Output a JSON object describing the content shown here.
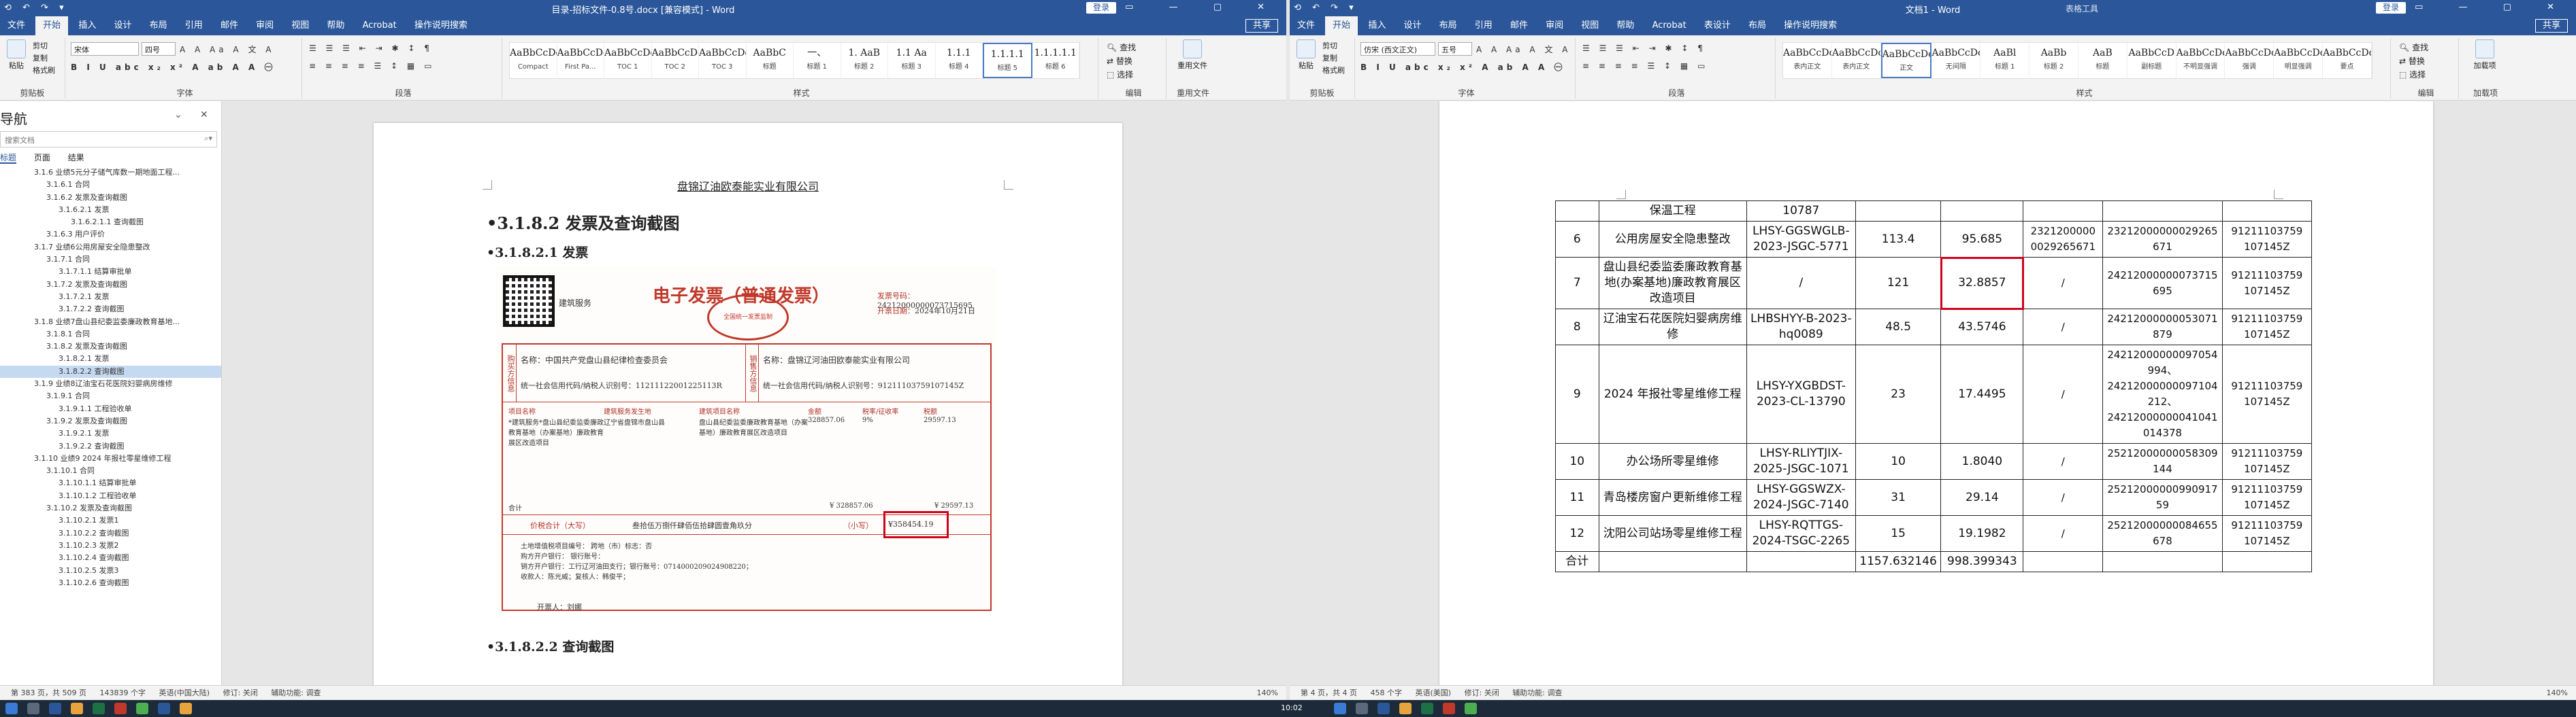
{
  "colors": {
    "accent": "#2b579a",
    "invoice_red": "#c0392b",
    "highlight": "#d0021b",
    "taskbar": "#1c2a3a"
  },
  "left": {
    "title": "目录-招标文件-0.8号.docx [兼容模式] - Word",
    "login": "登录",
    "tabs": [
      "文件",
      "开始",
      "插入",
      "设计",
      "布局",
      "引用",
      "邮件",
      "审阅",
      "视图",
      "帮助",
      "Acrobat",
      "操作说明搜索"
    ],
    "share": "共享",
    "clipboard": {
      "paste": "粘贴",
      "cut": "剪切",
      "copy": "复制",
      "painter": "格式刷",
      "label": "剪贴板"
    },
    "font": {
      "name": "宋体",
      "size": "四号",
      "label": "字体"
    },
    "paragraph_label": "段落",
    "styles": [
      {
        "pv": "AaBbCcDd",
        "nm": "Compact"
      },
      {
        "pv": "AaBbCcDd",
        "nm": "First Pa..."
      },
      {
        "pv": "AaBbCcDd",
        "nm": "TOC 1"
      },
      {
        "pv": "AaBbCcDd",
        "nm": "TOC 2"
      },
      {
        "pv": "AaBbCcDd",
        "nm": "TOC 3"
      },
      {
        "pv": "AaBbC",
        "nm": "标题"
      },
      {
        "pv": "一、",
        "nm": "标题 1"
      },
      {
        "pv": "1. AaB",
        "nm": "标题 2"
      },
      {
        "pv": "1.1 Aa",
        "nm": "标题 3"
      },
      {
        "pv": "1.1.1",
        "nm": "标题 4"
      },
      {
        "pv": "1.1.1.1",
        "nm": "标题 5"
      },
      {
        "pv": "1.1.1.1.1",
        "nm": "标题 6"
      }
    ],
    "styles_label": "样式",
    "editing": {
      "find": "查找",
      "replace": "替换",
      "select": "选择",
      "label": "编辑"
    },
    "reuse": {
      "btn": "重用文件",
      "label": "重用文件"
    },
    "nav": {
      "title": "导航",
      "search_placeholder": "搜索文档",
      "tabs": [
        "标题",
        "页面",
        "结果"
      ],
      "items": [
        "3.1.6 业绩5元分子储气库数一期地面工程...",
        "3.1.6.1 合同",
        "3.1.6.2 发票及查询截图",
        "3.1.6.2.1 发票",
        "3.1.6.2.1.1 查询截图",
        "3.1.6.3 用户评价",
        "3.1.7 业绩6公用房屋安全隐患整改",
        "3.1.7.1 合同",
        "3.1.7.1.1 结算审批单",
        "3.1.7.2 发票及查询截图",
        "3.1.7.2.1 发票",
        "3.1.7.2.2 查询截图",
        "3.1.8 业绩7盘山县纪委监委廉政教育基地...",
        "3.1.8.1 合同",
        "3.1.8.2 发票及查询截图",
        "3.1.8.2.1 发票",
        "3.1.8.2.2 查询截图",
        "3.1.9 业绩8辽油宝石花医院妇婴病房维修",
        "3.1.9.1 合同",
        "3.1.9.1.1 工程验收单",
        "3.1.9.2 发票及查询截图",
        "3.1.9.2.1 发票",
        "3.1.9.2.2 查询截图",
        "3.1.10 业绩9 2024 年报社零星维修工程",
        "3.1.10.1 合同",
        "3.1.10.1.1 结算审批单",
        "3.1.10.1.2 工程验收单",
        "3.1.10.2 发票及查询截图",
        "3.1.10.2.1 发票1",
        "3.1.10.2.2 查询截图",
        "3.1.10.2.3 发票2",
        "3.1.10.2.4 查询截图",
        "3.1.10.2.5 发票3",
        "3.1.10.2.6 查询截图"
      ],
      "selected_index": 16
    },
    "page": {
      "header": "盘锦辽油欧泰能实业有限公司",
      "h1": "3.1.8.2  发票及查询截图",
      "h2": "3.1.8.2.1  发票",
      "h3": "3.1.8.2.2  查询截图"
    },
    "invoice": {
      "qr_label": "建筑服务",
      "title": "电子发票（普通发票）",
      "seal": "全国统一发票监制",
      "no_label": "发票号码：",
      "no": "24212000000073715695",
      "date_label": "开票日期：",
      "date": "2024年10月21日",
      "buyer_label": "购买方信息",
      "buyer_name": "名称：中国共产党盘山县纪律检查委员会",
      "buyer_id": "统一社会信用代码/纳税人识别号：11211122001225113R",
      "seller_label": "销售方信息",
      "seller_name": "名称：盘锦辽河油田欧泰能实业有限公司",
      "seller_id": "统一社会信用代码/纳税人识别号：91211103759107145Z",
      "cols": [
        "项目名称",
        "建筑服务发生地",
        "建筑项目名称",
        "金额",
        "税率/征收率",
        "税额"
      ],
      "row": [
        "*建筑服务*盘山县纪委监委廉政教育基地（办案基地）廉政教育展区改造项目",
        "辽宁省盘锦市盘山县",
        "盘山县纪委监委廉政教育基地（办案基地）廉政教育展区改造项目",
        "328857.06",
        "9%",
        "29597.13"
      ],
      "sum_label": "合计",
      "sum_amount": "¥ 328857.06",
      "sum_tax": "¥ 29597.13",
      "total_label": "价税合计（大写）",
      "total_words": "叁拾伍万捌仟肆佰伍拾肆圆壹角玖分",
      "total_small_label": "（小写）",
      "total": "¥358454.19",
      "remarks": "土地增值税项目编号：  跨地（市）标志：否",
      "remarks2": "购方开户银行：  银行账号：",
      "remarks3": "销方开户银行：工行辽河油田支行；银行账号：0714000209024908220；",
      "remarks4": "收款人：陈光威；复核人：韩俊平；",
      "issuer": "开票人：刘娜"
    },
    "status": {
      "page": "第 383 页，共 509 页",
      "words": "143839 个字",
      "lang": "英语(中国大陆)",
      "mode": "修订: 关闭",
      "access": "辅助功能: 调查",
      "zoom": "140%"
    }
  },
  "right": {
    "title": "文档1 - Word",
    "context_tab": "表格工具",
    "login": "登录",
    "tabs": [
      "文件",
      "开始",
      "插入",
      "设计",
      "布局",
      "引用",
      "邮件",
      "审阅",
      "视图",
      "帮助",
      "Acrobat",
      "表设计",
      "布局",
      "操作说明搜索"
    ],
    "share": "共享",
    "clipboard": {
      "paste": "粘贴",
      "cut": "剪切",
      "copy": "复制",
      "painter": "格式刷",
      "label": "剪贴板"
    },
    "font": {
      "name": "仿宋 (西文正文)",
      "size": "五号",
      "label": "字体"
    },
    "paragraph_label": "段落",
    "styles": [
      {
        "pv": "AaBbCcDc",
        "nm": "表内正文"
      },
      {
        "pv": "AaBbCcDc",
        "nm": "表内正文"
      },
      {
        "pv": "AaBbCcDc",
        "nm": "正文"
      },
      {
        "pv": "AaBbCcDc",
        "nm": "无间隔"
      },
      {
        "pv": "AaBl",
        "nm": "标题 1"
      },
      {
        "pv": "AaBb",
        "nm": "标题 2"
      },
      {
        "pv": "AaB",
        "nm": "标题"
      },
      {
        "pv": "AaBbCcD",
        "nm": "副标题"
      },
      {
        "pv": "AaBbCcDc",
        "nm": "不明显强调"
      },
      {
        "pv": "AaBbCcDc",
        "nm": "强调"
      },
      {
        "pv": "AaBbCcDc",
        "nm": "明显强调"
      },
      {
        "pv": "AaBbCcDc",
        "nm": "要点"
      }
    ],
    "styles_label": "样式",
    "editing": {
      "find": "查找",
      "replace": "替换",
      "select": "选择",
      "label": "编辑"
    },
    "reuse": {
      "btn": "加载项",
      "label": "加载项"
    },
    "table": {
      "rows": [
        {
          "no": "",
          "name": "保温工程",
          "contract": "10787",
          "amount": "",
          "invoice": "",
          "code": "",
          "ticket": "",
          "tax": ""
        },
        {
          "no": "6",
          "name": "公用房屋安全隐患整改",
          "contract": "LHSY-GGSWGLB-2023-JSGC-5771",
          "amount": "113.4",
          "invoice": "95.685",
          "code": "2321200000 0029265671",
          "ticket": "23212000000029265 671",
          "tax": "91211103759 107145Z"
        },
        {
          "no": "7",
          "name": "盘山县纪委监委廉政教育基地(办案基地)廉政教育展区改造项目",
          "contract": "/",
          "amount": "121",
          "invoice": "32.8857",
          "code": "/",
          "ticket": "24212000000073715 695",
          "tax": "91211103759 107145Z"
        },
        {
          "no": "8",
          "name": "辽油宝石花医院妇婴病房维修",
          "contract": "LHBSHYY-B-2023-hq0089",
          "amount": "48.5",
          "invoice": "43.5746",
          "code": "/",
          "ticket": "24212000000053071 879",
          "tax": "91211103759 107145Z"
        },
        {
          "no": "9",
          "name": "2024 年报社零星维修工程",
          "contract": "LHSY-YXGBDST-2023-CL-13790",
          "amount": "23",
          "invoice": "17.4495",
          "code": "/",
          "ticket": "24212000000097054 994、24212000000097104 212、24212000000041041 014378",
          "tax": "91211103759 107145Z"
        },
        {
          "no": "10",
          "name": "办公场所零星维修",
          "contract": "LHSY-RLIYTJIX-2025-JSGC-1071",
          "amount": "10",
          "invoice": "1.8040",
          "code": "/",
          "ticket": "25212000000058309 144",
          "tax": "91211103759 107145Z"
        },
        {
          "no": "11",
          "name": "青岛楼房窗户更新维修工程",
          "contract": "LHSY-GGSWZX-2024-JSGC-7140",
          "amount": "31",
          "invoice": "29.14",
          "code": "/",
          "ticket": "25212000000990917 59",
          "tax": "91211103759 107145Z"
        },
        {
          "no": "12",
          "name": "沈阳公司站场零星维修工程",
          "contract": "LHSY-RQTTGS-2024-TSGC-2265",
          "amount": "15",
          "invoice": "19.1982",
          "code": "/",
          "ticket": "25212000000084655 678",
          "tax": "91211103759 107145Z"
        },
        {
          "no": "合计",
          "name": "",
          "contract": "",
          "amount": "1157.632146",
          "invoice": "998.399343",
          "code": "",
          "ticket": "",
          "tax": ""
        }
      ],
      "highlight": "32.8857"
    },
    "status": {
      "page": "第 4 页，共 4 页",
      "words": "458 个字",
      "lang": "英语(美国)",
      "mode": "修订: 关闭",
      "access": "辅助功能: 调查",
      "zoom": "140%"
    }
  },
  "taskbar": {
    "time": "10:02"
  }
}
